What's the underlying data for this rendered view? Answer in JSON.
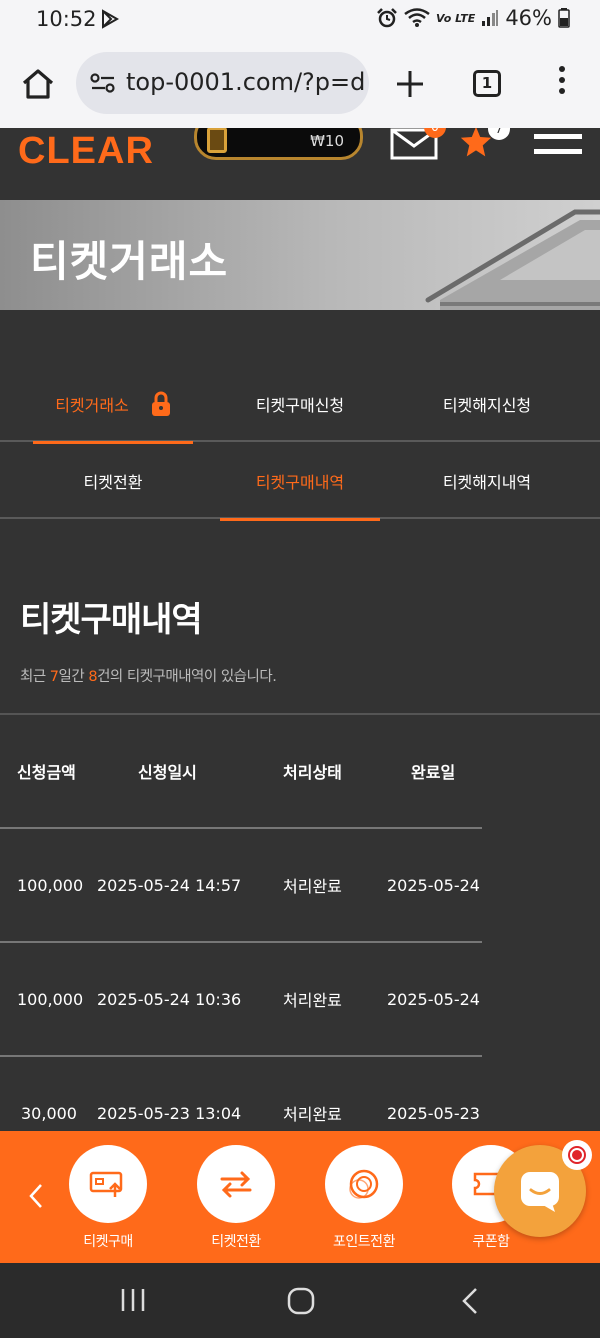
{
  "status_bar": {
    "time": "10:52",
    "network": "Vo LTE",
    "battery": "46%"
  },
  "browser": {
    "url": "top-0001.com/?p=d",
    "tab_count": "1"
  },
  "site_header": {
    "logo": "CLEAR",
    "wallet_amount": "₩10",
    "mail_badge": "0",
    "star_badge": "7"
  },
  "banner": {
    "title": "티켓거래소"
  },
  "tabs": {
    "row1": [
      {
        "label": "티켓거래소",
        "active": true
      },
      {
        "label": "티켓구매신청",
        "active": false
      },
      {
        "label": "티켓해지신청",
        "active": false
      }
    ],
    "row2": [
      {
        "label": "티켓전환",
        "active": false
      },
      {
        "label": "티켓구매내역",
        "active": true
      },
      {
        "label": "티켓해지내역",
        "active": false
      }
    ]
  },
  "section": {
    "title": "티켓구매내역",
    "summary_prefix": "최근 ",
    "summary_days": "7",
    "summary_mid": "일간 ",
    "summary_count": "8",
    "summary_suffix": "건의 티켓구매내역이 있습니다."
  },
  "table": {
    "headers": [
      "신청금액",
      "신청일시",
      "처리상태",
      "완료일"
    ],
    "rows": [
      [
        "100,000",
        "2025-05-24 14:57",
        "처리완료",
        "2025-05-24"
      ],
      [
        "100,000",
        "2025-05-24 10:36",
        "처리완료",
        "2025-05-24"
      ],
      [
        "30,000",
        "2025-05-23 13:04",
        "처리완료",
        "2025-05-23"
      ]
    ]
  },
  "quick_nav": {
    "items": [
      {
        "label": "티켓구매",
        "icon": "ticket-buy-icon"
      },
      {
        "label": "티켓전환",
        "icon": "exchange-icon"
      },
      {
        "label": "포인트전환",
        "icon": "coins-icon"
      },
      {
        "label": "쿠폰함",
        "icon": "coupon-icon"
      }
    ]
  },
  "colors": {
    "accent": "#ff6a1a",
    "background": "#333333",
    "chat": "#f3a23c"
  }
}
